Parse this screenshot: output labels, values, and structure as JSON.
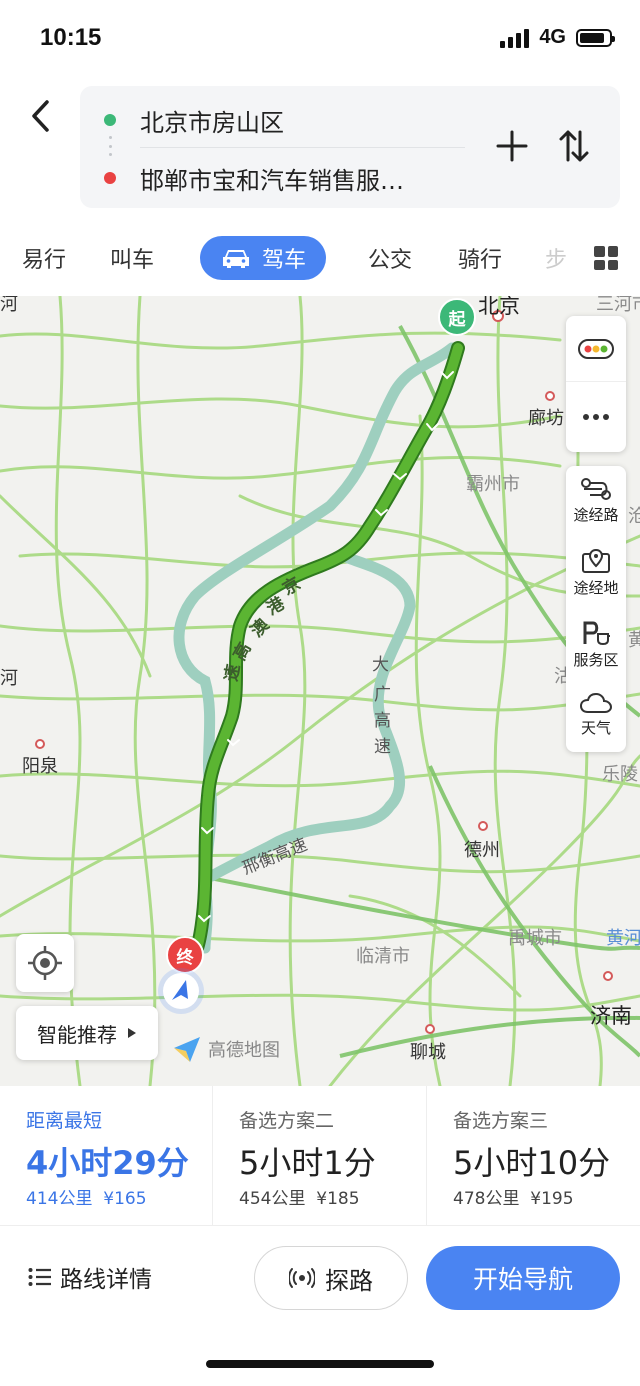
{
  "status": {
    "time": "10:15",
    "network": "4G",
    "battery_level": 0.85
  },
  "route": {
    "origin": "北京市房山区",
    "destination": "邯郸市宝和汽车销售服…",
    "colors": {
      "origin_dot": "#3cb878",
      "destination_dot": "#e94242"
    }
  },
  "tabs": [
    {
      "label": "易行"
    },
    {
      "label": "叫车"
    },
    {
      "label": "驾车",
      "active": true
    },
    {
      "label": "公交"
    },
    {
      "label": "骑行"
    },
    {
      "label": "步"
    }
  ],
  "map": {
    "cities": {
      "beijing": "北京",
      "langfang": "廊坊",
      "bazhou": "霸州市",
      "yangquan": "阳泉",
      "dezhou": "德州",
      "yucheng": "禹城市",
      "linqing": "临清市",
      "liaocheng": "聊城",
      "jinan": "济南",
      "leling": "乐陵",
      "huangjiang": "黄河",
      "sanhe": "三河市",
      "edge_left": "河",
      "edge_left2": "河",
      "edge_right": "沽",
      "edge_right2": "沧",
      "edge_right3": "黄"
    },
    "roads": {
      "jinggangao": [
        "京",
        "港",
        "澳",
        "高",
        "速"
      ],
      "daguang": [
        "大",
        "广",
        "高",
        "速"
      ],
      "xingheng": "邢衡高速"
    },
    "markers": {
      "start": "起",
      "end": "终"
    },
    "colors": {
      "route": "#5bb532",
      "alt_route": "#9ecfbf",
      "start": "#3cb878",
      "end": "#e94242",
      "nav_arrow": "#3a75e6"
    }
  },
  "side_tools": {
    "traffic": "traffic-light-icon",
    "more": "more-icon",
    "waypoints_route": "途经路",
    "waypoints_place": "途经地",
    "service_area": "服务区",
    "weather": "天气"
  },
  "controls": {
    "recommend": "智能推荐",
    "brand": "高德地图"
  },
  "plans": [
    {
      "title": "距离最短",
      "time": "4小时29分",
      "distance": "414公里",
      "cost": "¥165",
      "active": true
    },
    {
      "title": "备选方案二",
      "time": "5小时1分",
      "distance": "454公里",
      "cost": "¥185"
    },
    {
      "title": "备选方案三",
      "time": "5小时10分",
      "distance": "478公里",
      "cost": "¥195"
    }
  ],
  "actions": {
    "details": "路线详情",
    "explore": "探路",
    "start": "开始导航"
  }
}
